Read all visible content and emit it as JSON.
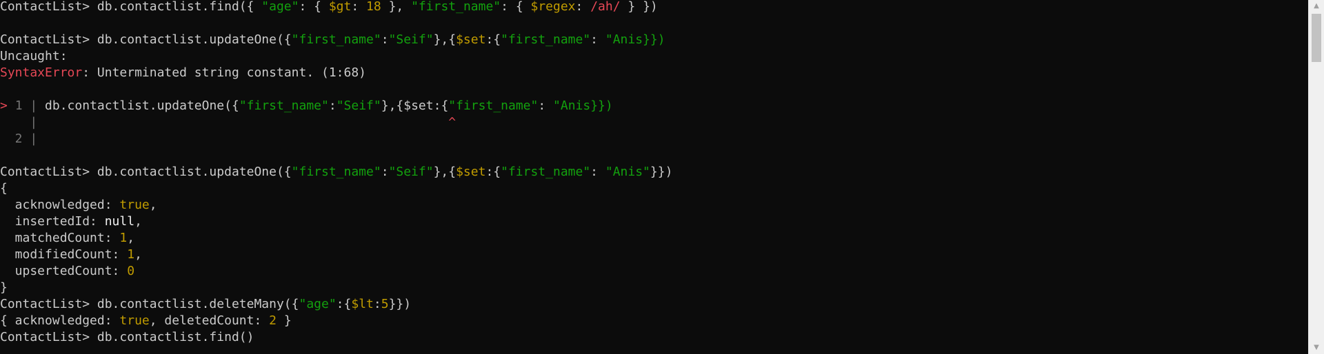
{
  "colors": {
    "background": "#0c0c0c",
    "default_text": "#cccccc",
    "bright_text": "#f2f2f2",
    "string": "#13a10e",
    "number": "#c19c00",
    "operator": "#c19c00",
    "regex": "#e74856",
    "error": "#e74856",
    "gutter": "#767676",
    "prompt_marker": "#e74856"
  },
  "prompt": "ContactList>",
  "lines": [
    [
      {
        "t": "ContactList> db.contactlist.find({ ",
        "c": "default_text"
      },
      {
        "t": "\"age\"",
        "c": "string"
      },
      {
        "t": ": { ",
        "c": "default_text"
      },
      {
        "t": "$gt",
        "c": "operator"
      },
      {
        "t": ": ",
        "c": "default_text"
      },
      {
        "t": "18",
        "c": "number"
      },
      {
        "t": " }, ",
        "c": "default_text"
      },
      {
        "t": "\"first_name\"",
        "c": "string"
      },
      {
        "t": ": { ",
        "c": "default_text"
      },
      {
        "t": "$regex",
        "c": "operator"
      },
      {
        "t": ": ",
        "c": "default_text"
      },
      {
        "t": "/ah/",
        "c": "regex"
      },
      {
        "t": " } })",
        "c": "default_text"
      }
    ],
    [],
    [
      {
        "t": "ContactList> db.contactlist.updateOne({",
        "c": "default_text"
      },
      {
        "t": "\"first_name\"",
        "c": "string"
      },
      {
        "t": ":",
        "c": "default_text"
      },
      {
        "t": "\"Seif\"",
        "c": "string"
      },
      {
        "t": "},{",
        "c": "default_text"
      },
      {
        "t": "$set",
        "c": "operator"
      },
      {
        "t": ":{",
        "c": "default_text"
      },
      {
        "t": "\"first_name\"",
        "c": "string"
      },
      {
        "t": ": ",
        "c": "default_text"
      },
      {
        "t": "\"Anis}})",
        "c": "string"
      }
    ],
    [
      {
        "t": "Uncaught:",
        "c": "default_text"
      }
    ],
    [
      {
        "t": "SyntaxError",
        "c": "error"
      },
      {
        "t": ": Unterminated string constant. (1:68)",
        "c": "default_text"
      }
    ],
    [],
    [
      {
        "t": "> ",
        "c": "prompt_marker"
      },
      {
        "t": "1 | ",
        "c": "gutter"
      },
      {
        "t": "db.contactlist.updateOne({",
        "c": "default_text"
      },
      {
        "t": "\"first_name\"",
        "c": "string"
      },
      {
        "t": ":",
        "c": "default_text"
      },
      {
        "t": "\"Seif\"",
        "c": "string"
      },
      {
        "t": "},{",
        "c": "default_text"
      },
      {
        "t": "$set",
        "c": "default_text"
      },
      {
        "t": ":{",
        "c": "default_text"
      },
      {
        "t": "\"first_name\"",
        "c": "string"
      },
      {
        "t": ": ",
        "c": "default_text"
      },
      {
        "t": "\"Anis}})",
        "c": "string"
      }
    ],
    [
      {
        "t": "    |                                                       ",
        "c": "gutter"
      },
      {
        "t": "^",
        "c": "error"
      }
    ],
    [
      {
        "t": "  2 |",
        "c": "gutter"
      }
    ],
    [],
    [
      {
        "t": "ContactList> db.contactlist.updateOne({",
        "c": "default_text"
      },
      {
        "t": "\"first_name\"",
        "c": "string"
      },
      {
        "t": ":",
        "c": "default_text"
      },
      {
        "t": "\"Seif\"",
        "c": "string"
      },
      {
        "t": "},{",
        "c": "default_text"
      },
      {
        "t": "$set",
        "c": "operator"
      },
      {
        "t": ":{",
        "c": "default_text"
      },
      {
        "t": "\"first_name\"",
        "c": "string"
      },
      {
        "t": ": ",
        "c": "default_text"
      },
      {
        "t": "\"Anis\"",
        "c": "string"
      },
      {
        "t": "}})",
        "c": "default_text"
      }
    ],
    [
      {
        "t": "{",
        "c": "default_text"
      }
    ],
    [
      {
        "t": "  acknowledged: ",
        "c": "default_text"
      },
      {
        "t": "true",
        "c": "number"
      },
      {
        "t": ",",
        "c": "default_text"
      }
    ],
    [
      {
        "t": "  insertedId: ",
        "c": "default_text"
      },
      {
        "t": "null",
        "c": "bright_text"
      },
      {
        "t": ",",
        "c": "default_text"
      }
    ],
    [
      {
        "t": "  matchedCount: ",
        "c": "default_text"
      },
      {
        "t": "1",
        "c": "number"
      },
      {
        "t": ",",
        "c": "default_text"
      }
    ],
    [
      {
        "t": "  modifiedCount: ",
        "c": "default_text"
      },
      {
        "t": "1",
        "c": "number"
      },
      {
        "t": ",",
        "c": "default_text"
      }
    ],
    [
      {
        "t": "  upsertedCount: ",
        "c": "default_text"
      },
      {
        "t": "0",
        "c": "number"
      }
    ],
    [
      {
        "t": "}",
        "c": "default_text"
      }
    ],
    [
      {
        "t": "ContactList> db.contactlist.deleteMany({",
        "c": "default_text"
      },
      {
        "t": "\"age\"",
        "c": "string"
      },
      {
        "t": ":{",
        "c": "default_text"
      },
      {
        "t": "$lt",
        "c": "operator"
      },
      {
        "t": ":",
        "c": "default_text"
      },
      {
        "t": "5",
        "c": "number"
      },
      {
        "t": "}})",
        "c": "default_text"
      }
    ],
    [
      {
        "t": "{ acknowledged: ",
        "c": "default_text"
      },
      {
        "t": "true",
        "c": "number"
      },
      {
        "t": ", deletedCount: ",
        "c": "default_text"
      },
      {
        "t": "2",
        "c": "number"
      },
      {
        "t": " }",
        "c": "default_text"
      }
    ],
    [
      {
        "t": "ContactList> db.contactlist.find()",
        "c": "default_text"
      }
    ]
  ],
  "scrollbar": {
    "up_icon": "arrow-up-icon",
    "down_icon": "arrow-down-icon",
    "up_glyph": "▲",
    "down_glyph": "▼"
  }
}
